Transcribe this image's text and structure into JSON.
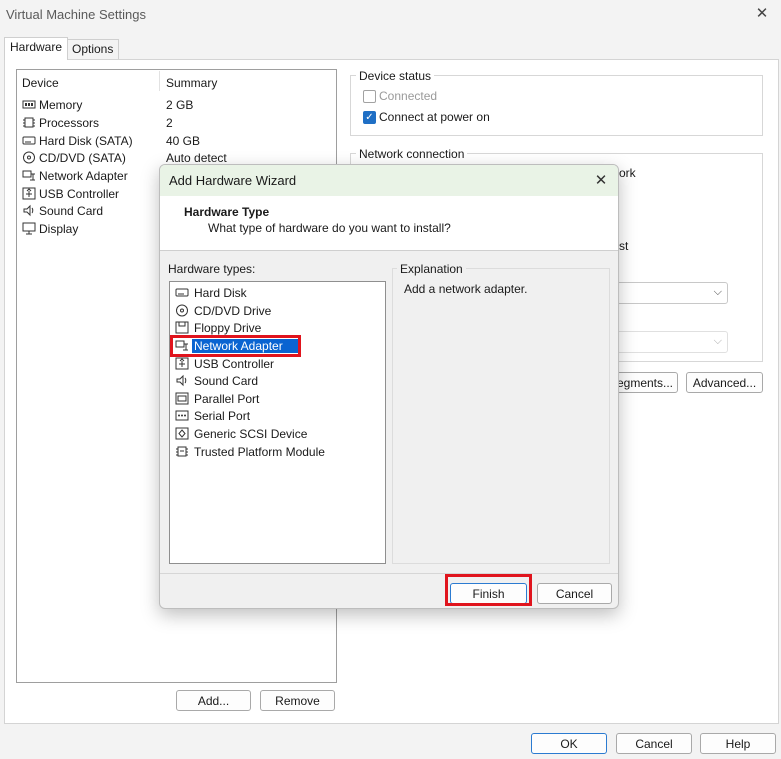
{
  "window": {
    "title": "Virtual Machine Settings"
  },
  "tabs": [
    {
      "label": "Hardware"
    },
    {
      "label": "Options"
    }
  ],
  "device_table": {
    "col_device": "Device",
    "col_summary": "Summary",
    "rows": [
      {
        "icon": "memory-icon",
        "device": "Memory",
        "summary": "2 GB"
      },
      {
        "icon": "processor-icon",
        "device": "Processors",
        "summary": "2"
      },
      {
        "icon": "hard-disk-icon",
        "device": "Hard Disk (SATA)",
        "summary": "40 GB"
      },
      {
        "icon": "cd-dvd-icon",
        "device": "CD/DVD (SATA)",
        "summary": "Auto detect"
      },
      {
        "icon": "network-adapter-icon",
        "device": "Network Adapter",
        "summary": ""
      },
      {
        "icon": "usb-icon",
        "device": "USB Controller",
        "summary": ""
      },
      {
        "icon": "sound-icon",
        "device": "Sound Card",
        "summary": ""
      },
      {
        "icon": "display-icon",
        "device": "Display",
        "summary": ""
      }
    ]
  },
  "device_buttons": {
    "add": "Add...",
    "remove": "Remove"
  },
  "device_status": {
    "label": "Device status",
    "connected": {
      "label": "Connected",
      "checked": false,
      "enabled": false
    },
    "connect_at_power_on": {
      "label": "Connect at power on",
      "checked": true
    }
  },
  "network_connection": {
    "label": "Network connection",
    "partial_1": "ork",
    "partial_2": "st"
  },
  "right_buttons": {
    "segments": "egments...",
    "advanced": "Advanced..."
  },
  "footer": {
    "ok": "OK",
    "cancel": "Cancel",
    "help": "Help"
  },
  "wizard": {
    "title": "Add Hardware Wizard",
    "heading": "Hardware Type",
    "subheading": "What type of hardware do you want to install?",
    "types_label": "Hardware types:",
    "types": [
      {
        "icon": "hard-disk-icon",
        "label": "Hard Disk"
      },
      {
        "icon": "cd-dvd-icon",
        "label": "CD/DVD Drive"
      },
      {
        "icon": "floppy-icon",
        "label": "Floppy Drive"
      },
      {
        "icon": "network-adapter-icon",
        "label": "Network Adapter"
      },
      {
        "icon": "usb-icon",
        "label": "USB Controller"
      },
      {
        "icon": "sound-icon",
        "label": "Sound Card"
      },
      {
        "icon": "parallel-port-icon",
        "label": "Parallel Port"
      },
      {
        "icon": "serial-port-icon",
        "label": "Serial Port"
      },
      {
        "icon": "scsi-icon",
        "label": "Generic SCSI Device"
      },
      {
        "icon": "tpm-icon",
        "label": "Trusted Platform Module"
      }
    ],
    "selected_type": "Network Adapter",
    "explanation_label": "Explanation",
    "explanation_text": "Add a network adapter.",
    "finish": "Finish",
    "cancel": "Cancel"
  },
  "colors": {
    "highlight_red": "#e0141d",
    "selection_blue": "#0a64d1",
    "checkbox_blue": "#1f6fc5"
  }
}
